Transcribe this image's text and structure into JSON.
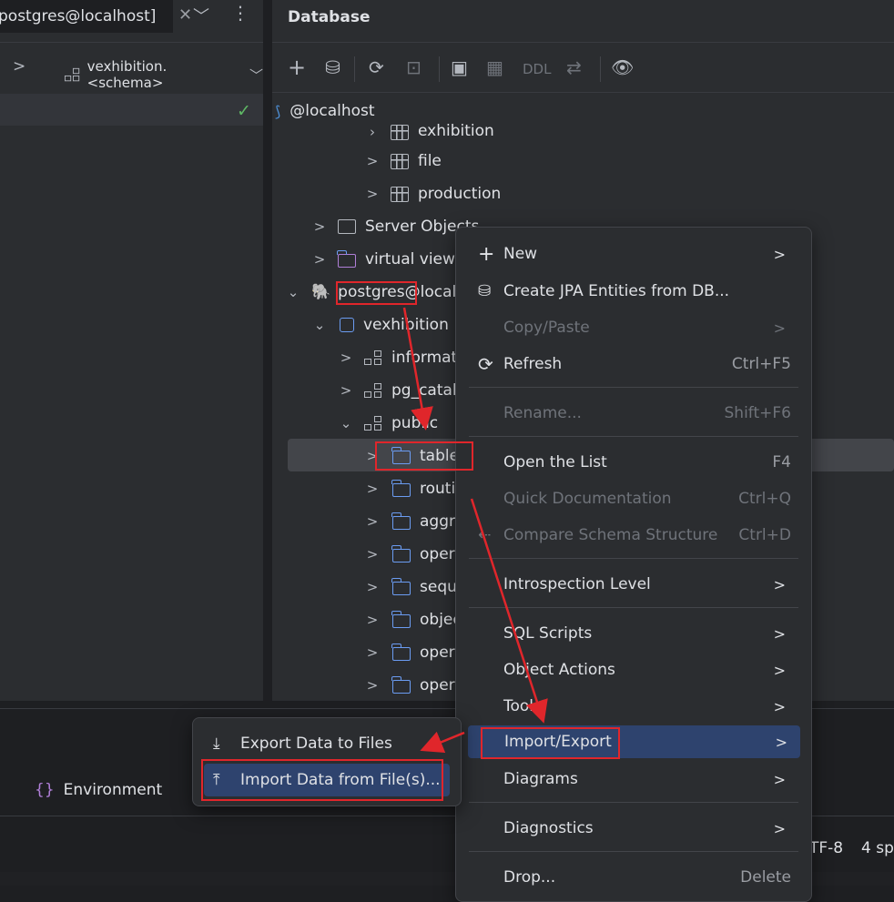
{
  "left_panel": {
    "tab_label": "postgres@localhost]",
    "schema_selector": "vexhibition.<schema>"
  },
  "database_panel": {
    "title": "Database",
    "toolbar_ddl": "DDL",
    "tree": [
      {
        "label": "@localhost"
      },
      {
        "label": "exhibition"
      },
      {
        "label": "file"
      },
      {
        "label": "production"
      },
      {
        "label": "Server Objects"
      },
      {
        "label": "virtual views"
      },
      {
        "label": "postgres@localhost"
      },
      {
        "label": "vexhibition"
      },
      {
        "label": "information_schema"
      },
      {
        "label": "pg_catalog"
      },
      {
        "label": "public"
      },
      {
        "label": "tables"
      },
      {
        "label": "routines"
      },
      {
        "label": "aggregates"
      },
      {
        "label": "operators"
      },
      {
        "label": "sequences"
      },
      {
        "label": "object types"
      },
      {
        "label": "operator classes"
      },
      {
        "label": "operator families"
      }
    ]
  },
  "context_menu": {
    "items": [
      {
        "label": "New"
      },
      {
        "label": "Create JPA Entities from DB..."
      },
      {
        "label": "Copy/Paste"
      },
      {
        "label": "Refresh",
        "shortcut": "Ctrl+F5"
      },
      {
        "label": "Rename...",
        "shortcut": "Shift+F6"
      },
      {
        "label": "Open the List",
        "shortcut": "F4"
      },
      {
        "label": "Quick Documentation",
        "shortcut": "Ctrl+Q"
      },
      {
        "label": "Compare Schema Structure",
        "shortcut": "Ctrl+D"
      },
      {
        "label": "Introspection Level"
      },
      {
        "label": "SQL Scripts"
      },
      {
        "label": "Object Actions"
      },
      {
        "label": "Tools"
      },
      {
        "label": "Import/Export"
      },
      {
        "label": "Diagrams"
      },
      {
        "label": "Diagnostics"
      },
      {
        "label": "Drop...",
        "shortcut": "Delete"
      }
    ]
  },
  "submenu": {
    "export_label": "Export Data to Files",
    "import_label": "Import Data from File(s)..."
  },
  "bottom": {
    "environment_tab": "Environment",
    "encoding": "TF-8",
    "indent": "4 sp"
  },
  "colors": {
    "highlight_red": "#e0262b",
    "selection_blue": "#2e436e",
    "folder_blue": "#6b9cf2"
  }
}
